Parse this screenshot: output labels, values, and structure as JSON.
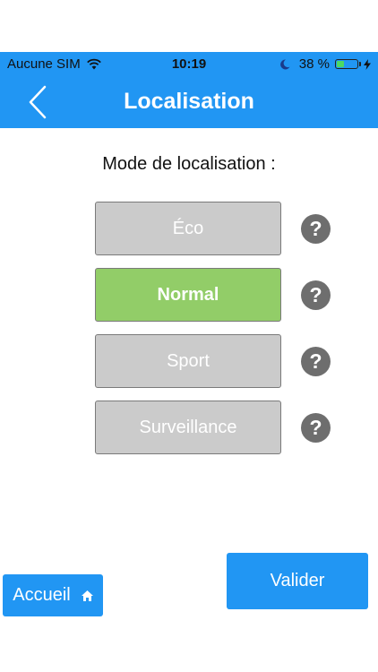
{
  "status_bar": {
    "carrier": "Aucune SIM",
    "time": "10:19",
    "battery_text": "38 %",
    "battery_level": 0.38,
    "icons": [
      "wifi-icon",
      "moon-icon",
      "battery-icon",
      "charging-bolt-icon"
    ]
  },
  "nav": {
    "title": "Localisation",
    "back_icon": "chevron-left-icon"
  },
  "mode_label": "Mode de localisation :",
  "modes": [
    {
      "label": "Éco",
      "active": false
    },
    {
      "label": "Normal",
      "active": true
    },
    {
      "label": "Sport",
      "active": false
    },
    {
      "label": "Surveillance",
      "active": false
    }
  ],
  "help_glyph": "?",
  "footer": {
    "home_label": "Accueil",
    "home_icon": "home-icon",
    "validate_label": "Valider"
  },
  "colors": {
    "primary": "#2196F3",
    "active_mode": "#92CD68",
    "inactive_mode": "#CBCBCB",
    "help_icon": "#6E6E6E"
  }
}
